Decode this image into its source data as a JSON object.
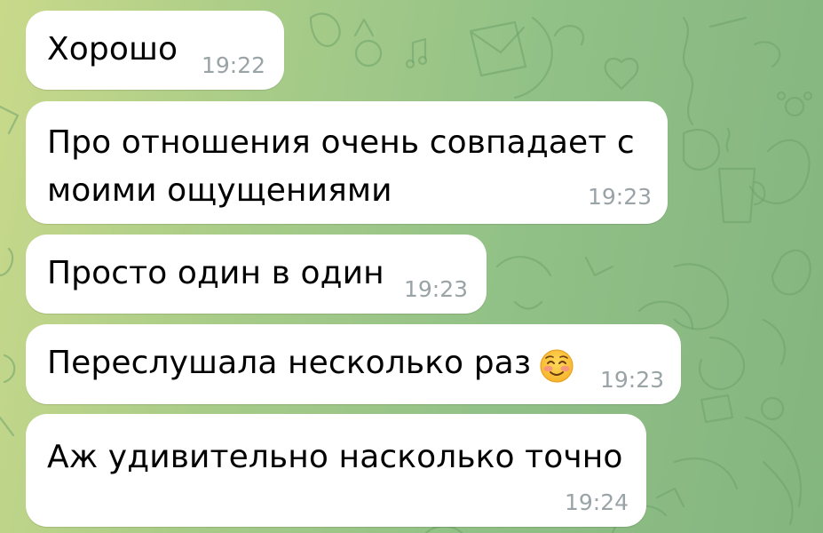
{
  "chat": {
    "messages": [
      {
        "text": "Хорошо",
        "time": "19:22"
      },
      {
        "text": "Про отношения очень совпадает с\nмоими ощущениями",
        "time": "19:23"
      },
      {
        "text": "Просто один в один",
        "time": "19:23"
      },
      {
        "text": "Переслушала несколько раз",
        "emoji": "smiling-face-with-blush",
        "time": "19:23"
      },
      {
        "text": "Аж удивительно насколько точно",
        "time": "19:24"
      }
    ]
  },
  "colors": {
    "bubble": "#ffffff",
    "timestamp": "#9aa3a6",
    "background_left": "#c9d98a",
    "background_right": "#84b57f"
  }
}
